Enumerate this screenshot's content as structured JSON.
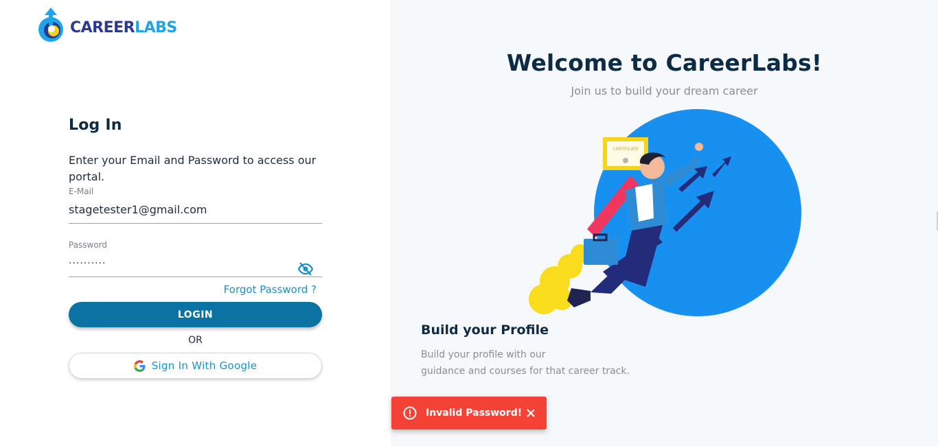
{
  "brand": {
    "logo_part1": "CAREER",
    "logo_part2": "LABS",
    "color_primary": "#2b3a8f",
    "color_accent": "#1ea4e8"
  },
  "login": {
    "title": "Log In",
    "description": "Enter your Email and Password to access our portal.",
    "email_label": "E-Mail",
    "email_value": "stagetester1@gmail.com",
    "password_label": "Password",
    "password_value": "··········",
    "forgot_password": "Forgot Password ?",
    "login_button": "LOGIN",
    "or_text": "OR",
    "google_button": "Sign In With Google",
    "visibility_icon": "eye-off-icon"
  },
  "hero": {
    "title": "Welcome to CareerLabs!",
    "subtitle": "Join us to build your dream career",
    "certificate_text": "CERTIFICATE",
    "feature_title": "Build your Profile",
    "feature_desc_line1": "Build your profile with our",
    "feature_desc_line2": "guidance and courses for that career track."
  },
  "toast": {
    "message": "Invalid Password!",
    "icon": "alert-circle-icon",
    "close_icon": "close-icon",
    "color": "#f44336"
  },
  "colors": {
    "button_primary": "#0a73a3",
    "link": "#1a91c6",
    "circle": "#1890f0"
  }
}
